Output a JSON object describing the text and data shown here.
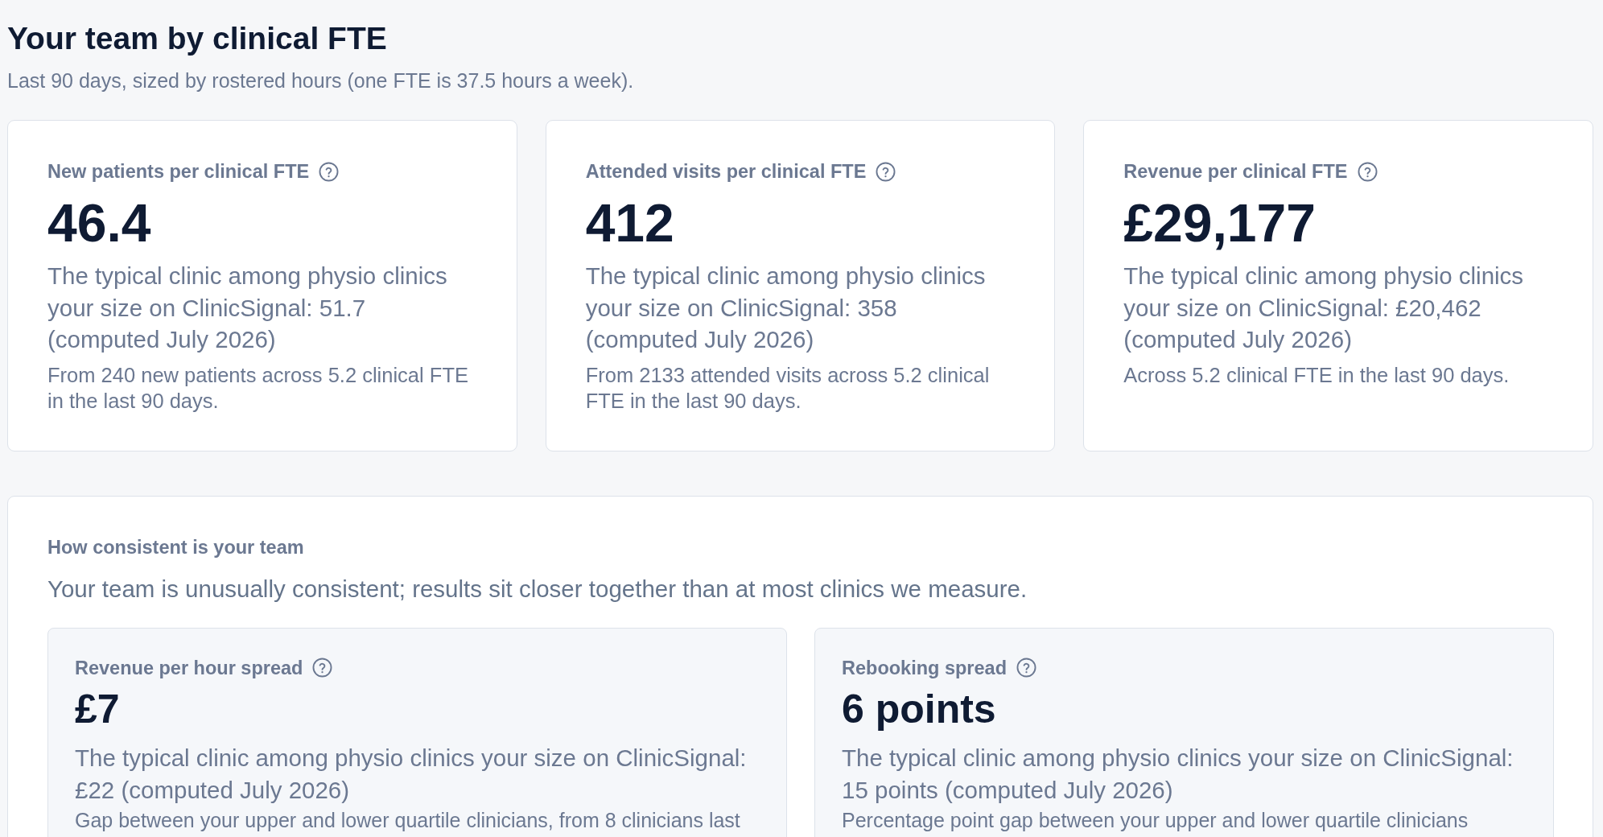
{
  "header": {
    "title": "Your team by clinical FTE",
    "subtitle": "Last 90 days, sized by rostered hours (one FTE is 37.5 hours a week)."
  },
  "metric_cards": [
    {
      "label": "New patients per clinical FTE",
      "value": "46.4",
      "benchmark": "The typical clinic among physio clinics your size on ClinicSignal: 51.7 (computed July 2026)",
      "note": "From 240 new patients across 5.2 clinical FTE in the last 90 days."
    },
    {
      "label": "Attended visits per clinical FTE",
      "value": "412",
      "benchmark": "The typical clinic among physio clinics your size on ClinicSignal: 358 (computed July 2026)",
      "note": "From 2133 attended visits across 5.2 clinical FTE in the last 90 days."
    },
    {
      "label": "Revenue per clinical FTE",
      "value": "£29,177",
      "benchmark": "The typical clinic among physio clinics your size on ClinicSignal: £20,462 (computed July 2026)",
      "note": "Across 5.2 clinical FTE in the last 90 days."
    }
  ],
  "consistency": {
    "title": "How consistent is your team",
    "summary": "Your team is unusually consistent; results sit closer together than at most clinics we measure.",
    "cards": [
      {
        "label": "Revenue per hour spread",
        "value": "£7",
        "benchmark": "The typical clinic among physio clinics your size on ClinicSignal: £22 (computed July 2026)",
        "note": "Gap between your upper and lower quartile clinicians, from 8 clinicians last"
      },
      {
        "label": "Rebooking spread",
        "value": "6 points",
        "benchmark": "The typical clinic among physio clinics your size on ClinicSignal: 15 points (computed July 2026)",
        "note": "Percentage point gap between your upper and lower quartile clinicians"
      }
    ]
  }
}
